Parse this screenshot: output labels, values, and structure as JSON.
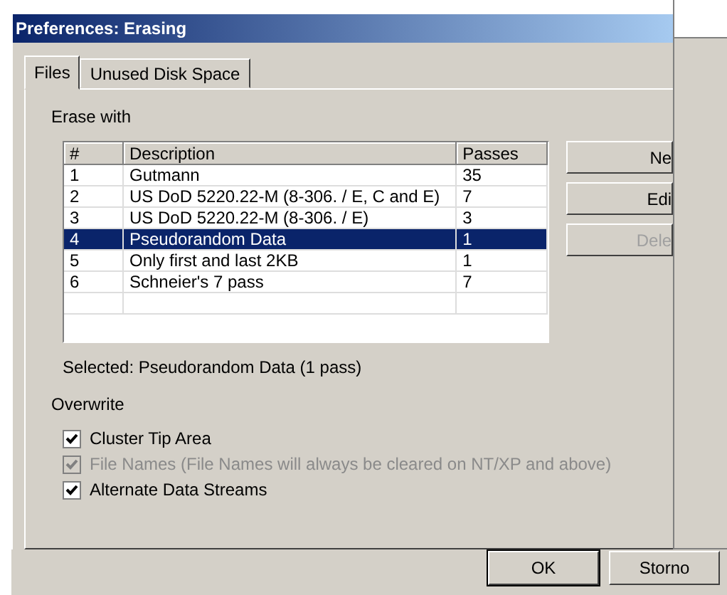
{
  "window": {
    "title": "Preferences: Erasing"
  },
  "tabs": [
    {
      "label": "Files",
      "selected": true
    },
    {
      "label": "Unused Disk Space",
      "selected": false
    }
  ],
  "erase_with": {
    "label": "Erase with",
    "columns": [
      "#",
      "Description",
      "Passes"
    ],
    "rows": [
      {
        "cells": [
          "1",
          "Gutmann",
          "35"
        ],
        "selected": false
      },
      {
        "cells": [
          "2",
          "US DoD 5220.22-M (8-306. / E, C and E)",
          "7"
        ],
        "selected": false
      },
      {
        "cells": [
          "3",
          "US DoD 5220.22-M (8-306. / E)",
          "3"
        ],
        "selected": false
      },
      {
        "cells": [
          "4",
          "Pseudorandom Data",
          "1"
        ],
        "selected": true
      },
      {
        "cells": [
          "5",
          "Only first and last 2KB",
          "1"
        ],
        "selected": false
      },
      {
        "cells": [
          "6",
          "Schneier's 7 pass",
          "7"
        ],
        "selected": false
      }
    ],
    "buttons": [
      {
        "label": "Ne",
        "disabled": false
      },
      {
        "label": "Edi",
        "disabled": false
      },
      {
        "label": "Dele",
        "disabled": true
      }
    ],
    "selected_text": "Selected: Pseudorandom Data (1 pass)"
  },
  "overwrite": {
    "label": "Overwrite",
    "options": [
      {
        "label": "Cluster Tip Area",
        "checked": true,
        "disabled": false
      },
      {
        "label": "File Names (File Names will always be cleared on NT/XP and above)",
        "checked": true,
        "disabled": true
      },
      {
        "label": "Alternate Data Streams",
        "checked": true,
        "disabled": false
      }
    ]
  },
  "footer": {
    "buttons": [
      "OK",
      "Storno"
    ]
  }
}
